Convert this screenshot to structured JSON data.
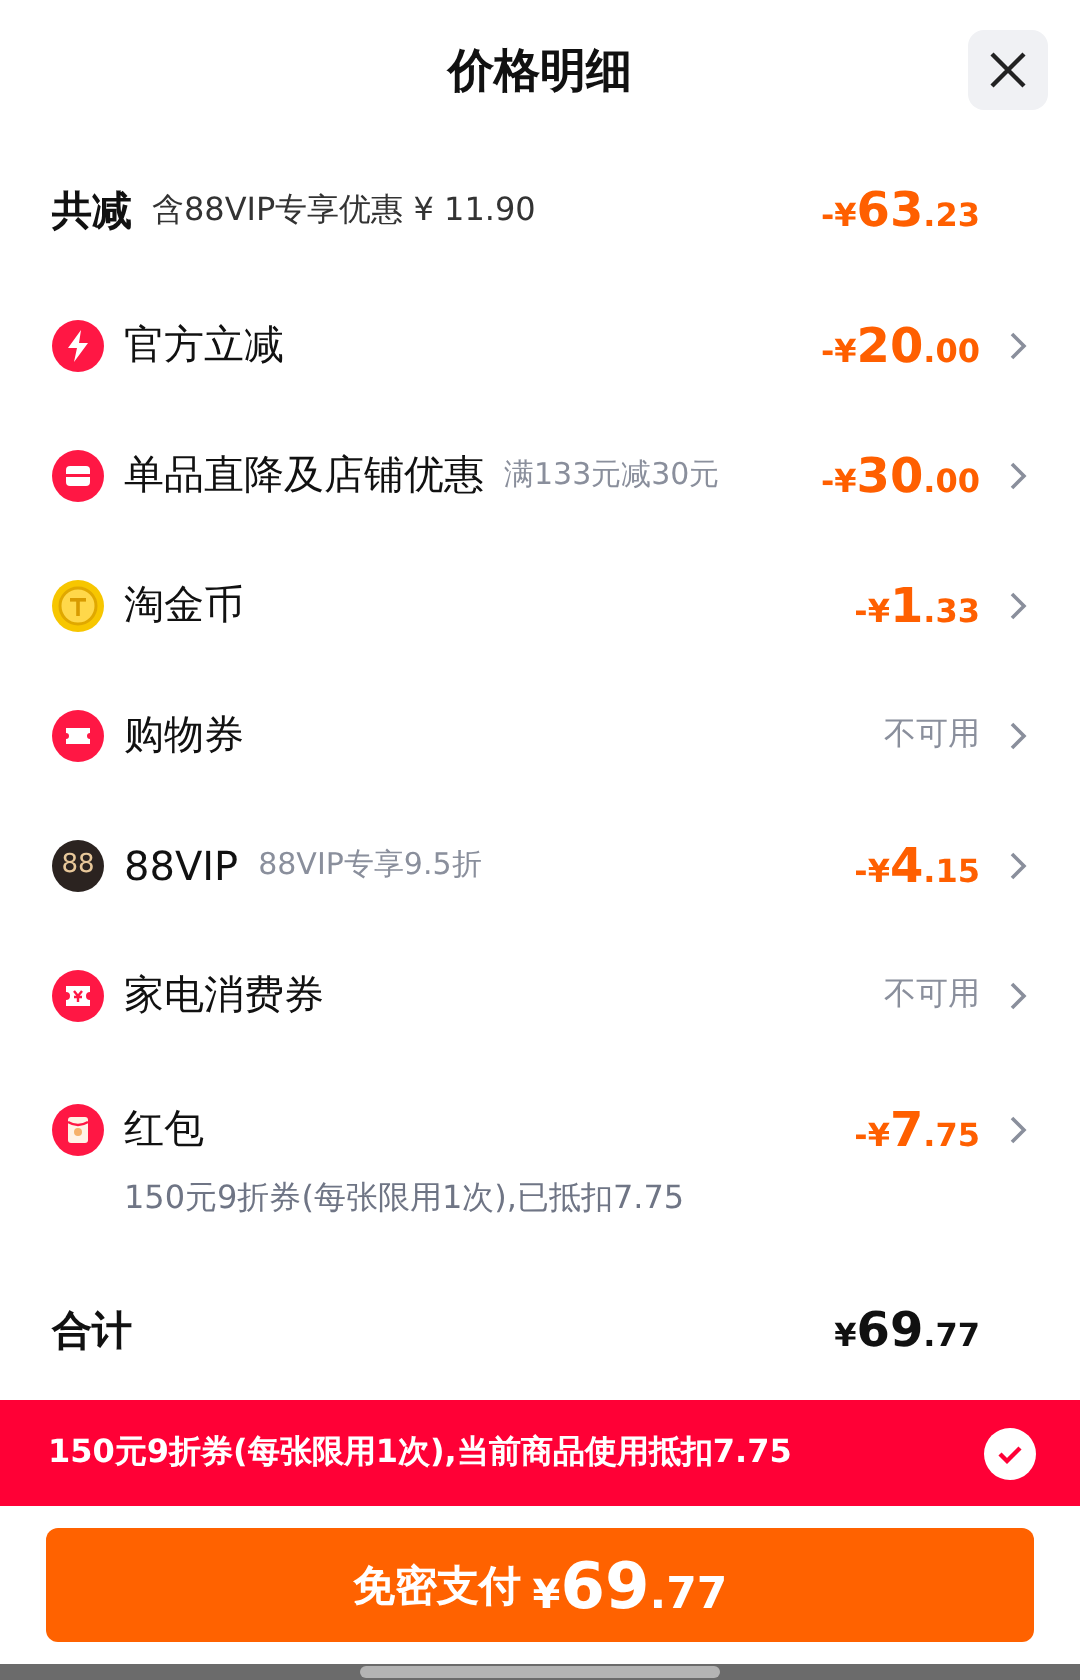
{
  "title": "价格明细",
  "summary": {
    "label": "共减",
    "note": "含88VIP专享优惠 ¥ 11.90",
    "amount": {
      "prefix": "-¥",
      "int": "63",
      "dec": ".23"
    }
  },
  "items": [
    {
      "kind": "bolt",
      "label": "官方立减",
      "amount": {
        "prefix": "-¥",
        "int": "20",
        "dec": ".00"
      }
    },
    {
      "kind": "store",
      "label": "单品直降及店铺优惠",
      "note": "满133元减30元",
      "amount": {
        "prefix": "-¥",
        "int": "30",
        "dec": ".00"
      }
    },
    {
      "kind": "coin",
      "label": "淘金币",
      "amount": {
        "prefix": "-¥",
        "int": "1",
        "dec": ".33"
      }
    },
    {
      "kind": "ticket",
      "label": "购物券",
      "status": "不可用"
    },
    {
      "kind": "vip",
      "icon_text": "88",
      "label": "88VIP",
      "note": "88VIP专享9.5折",
      "amount": {
        "prefix": "-¥",
        "int": "4",
        "dec": ".15"
      }
    },
    {
      "kind": "voucher",
      "label": "家电消费券",
      "status": "不可用"
    },
    {
      "kind": "redpacket",
      "label": "红包",
      "detail": "150元9折券(每张限用1次),已抵扣7.75",
      "amount": {
        "prefix": "-¥",
        "int": "7",
        "dec": ".75"
      }
    }
  ],
  "total": {
    "label": "合计",
    "amount": {
      "prefix": "¥",
      "int": "69",
      "dec": ".77"
    }
  },
  "banner": {
    "text": "150元9折券(每张限用1次),当前商品使用抵扣7.75",
    "checked": true
  },
  "pay_button": {
    "label": "免密支付",
    "amount": {
      "prefix": "¥",
      "int": "69",
      "dec": ".77"
    }
  }
}
